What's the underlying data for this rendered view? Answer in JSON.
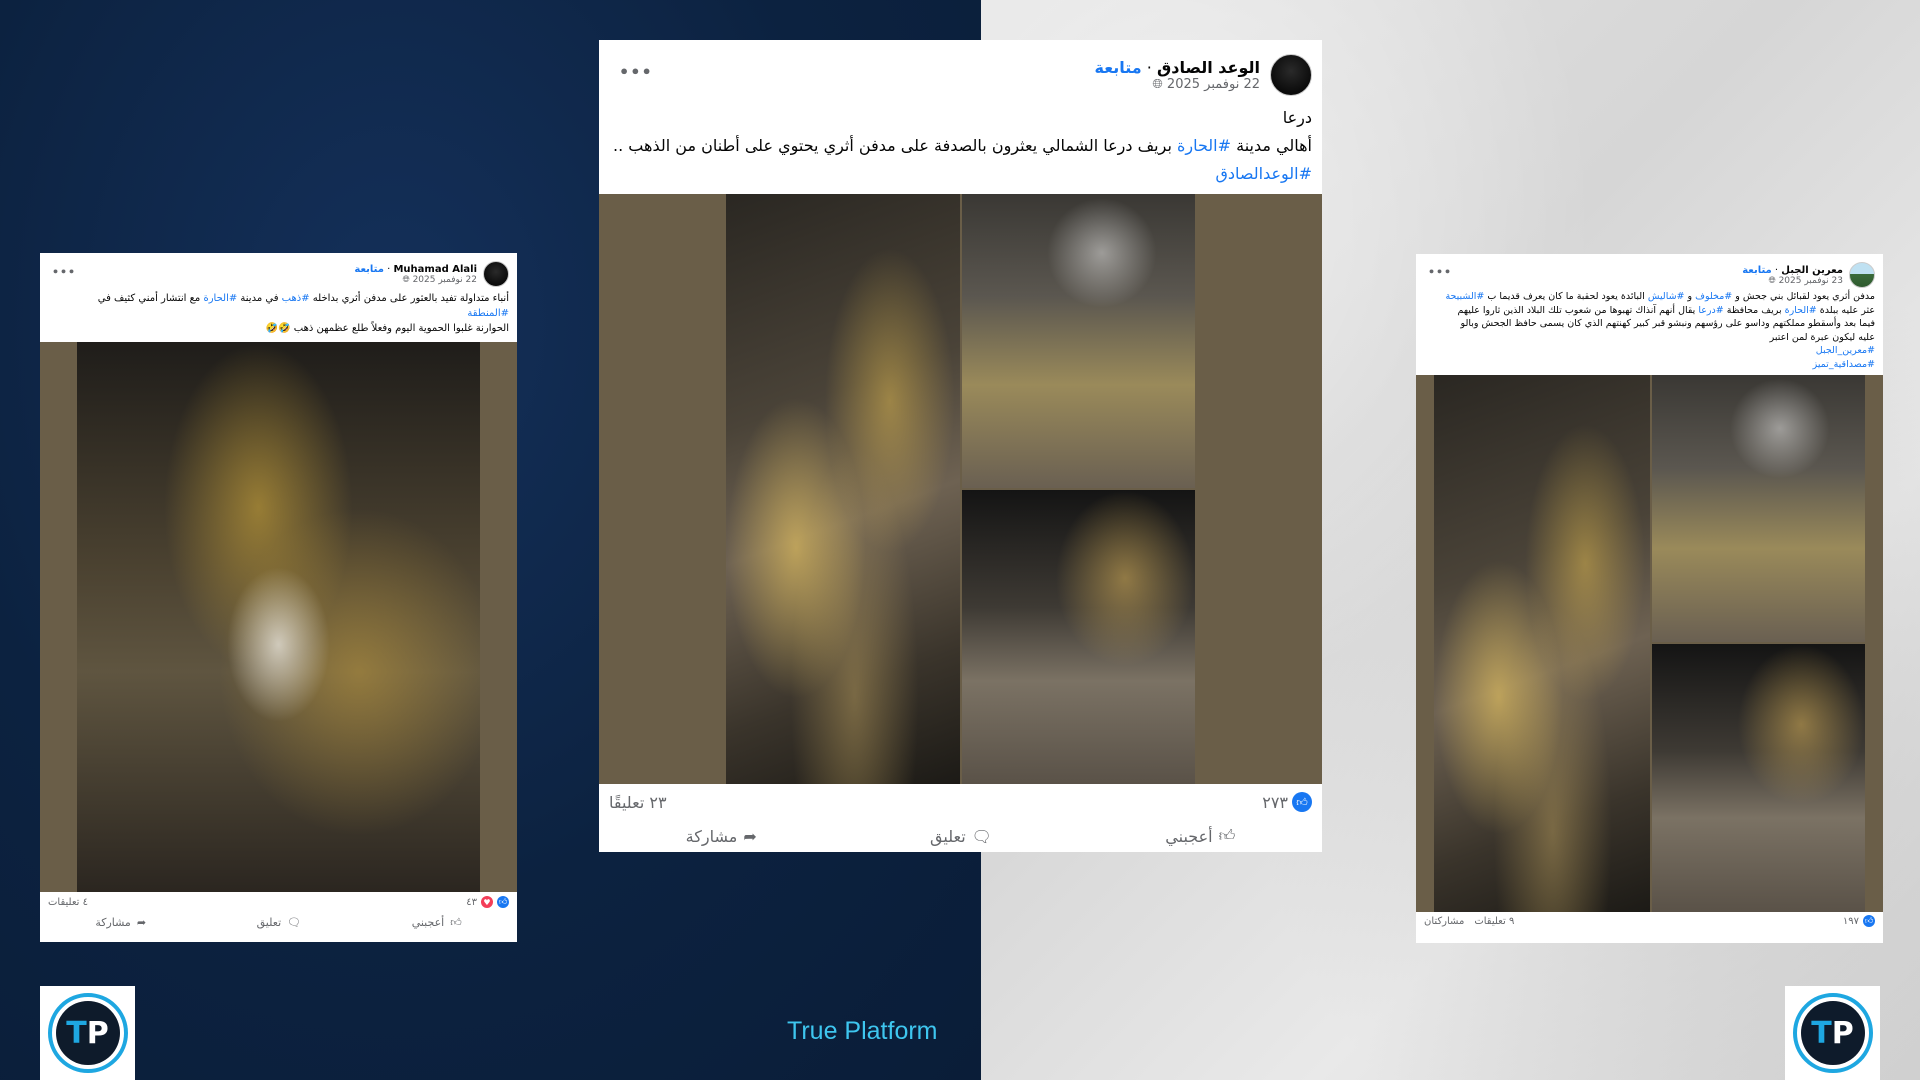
{
  "brand": {
    "platform_name": "True Platform",
    "logo_letters": "TP",
    "accent": "#1ea7e1"
  },
  "post_left": {
    "author": "Muhamad Alali",
    "follow": "متابعة",
    "date": "22 نوفمبر 2025",
    "text_pre1": "أنباء متداولة  تفيد بالعثور على مدفن أثري بداخله ",
    "tag_gold": "#ذهب",
    "text_pre2": " في مدينة ",
    "tag_town": "#الحارة",
    "text_post": " مع انتشار أمني كثيف في",
    "tag_region": "#المنطقة",
    "line3": "الحوارنة غلبوا الحموية اليوم وفعلاً طلع عظمهن ذهب 🤣🤣",
    "reactions": "٤٣",
    "comments": "٤ تعليقات",
    "like_label": "أعجبني",
    "comment_label": "تعليق",
    "share_label": "مشاركة"
  },
  "post_center": {
    "author": "الوعد الصادق",
    "follow": "متابعة",
    "date": "22 نوفمبر 2025",
    "line1": "درعا",
    "text_a": "أهالي مدينة ",
    "tag_town": "#الحارة",
    "text_b": " بريف درعا الشمالي يعثرون بالصدفة على مدفن أثري يحتوي على أطنان من الذهب ..",
    "tag_page": "#الوعدالصادق",
    "reactions": "٢٧٣",
    "comments": "٢٣ تعليقًا",
    "like_label": "أعجبني",
    "comment_label": "تعليق",
    "share_label": "مشاركة"
  },
  "post_right": {
    "author": "معرين الجبل",
    "follow": "متابعة",
    "date": "23 نوفمبر 2025",
    "t1": "مدفن أثري يعود لقبائل بني جحش و ",
    "tag1": "#مخلوف",
    "t2": " و ",
    "tag2": "#شاليش",
    "t3": " البائدة يعود لحقبة ما كان يعرف قديما ب ",
    "tag3": "#الشبيحة",
    "t4": "عثر عليه ببلدة ",
    "tag4": "#الحارة",
    "t5": " بريف محافظة ",
    "tag5": "#درعا",
    "t6": " يقال أنهم آنذاك تهبوها من شعوب تلك البلاد الذين ثاروا عليهم",
    "t7": "فيما بعد وأسقطو مملكتهم وداسو على رؤسهم ونبشو قبر كبير كهنتهم الذي كان يسمى حافظ الجحش وبالو",
    "t8": "عليه ليكون عبرة لمن اعتبر",
    "tag6": "#معرين_الجبل",
    "tag7": "#مصداقية_تميز",
    "reactions": "١٩٧",
    "comments": "٩ تعليقات",
    "shares": "مشاركتان"
  }
}
